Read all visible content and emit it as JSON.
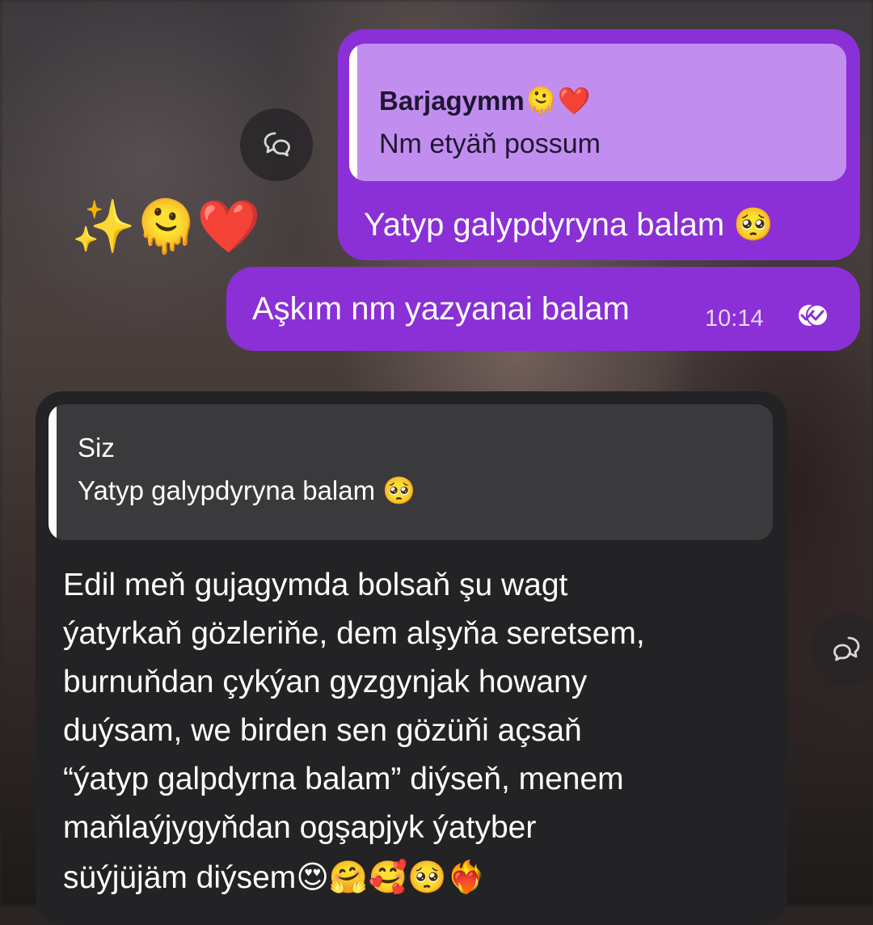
{
  "outgoing_reply": {
    "quote_author": "Barjagymm🫠❤️",
    "quote_text": "Nm etyäň possum",
    "message": "Yatyp galypdyryna balam 🥺"
  },
  "reactions": "✨🫠❤️",
  "outgoing_message": {
    "text": "Aşkım nm yazyanai balam",
    "time": "10:14",
    "status_icon": "double-check-icon"
  },
  "incoming_reply": {
    "quote_author": "Siz",
    "quote_text": "Yatyp galypdyryna balam 🥺",
    "lines": [
      "Edil meň gujagymda bolsaň şu wagt",
      "ýatyrkaň gözleriňe, dem alşyňa seretsem,",
      "burnuňdan çykýan gyzgynjak howany",
      "duýsam, we birden sen gözüňi açsaň",
      "“ýatyp galpdyrna balam” diýseň, menem",
      "maňlaýjygyňdan ogşapjyk ýatyber",
      "süýjüjäm diýsem😍🤗🥰🥺❤️‍🔥"
    ]
  },
  "colors": {
    "outgoing_bubble": "#8b2fd6",
    "outgoing_quote": "#c18ef0",
    "incoming_bubble": "#232224",
    "incoming_quote": "#3a3a3c"
  }
}
